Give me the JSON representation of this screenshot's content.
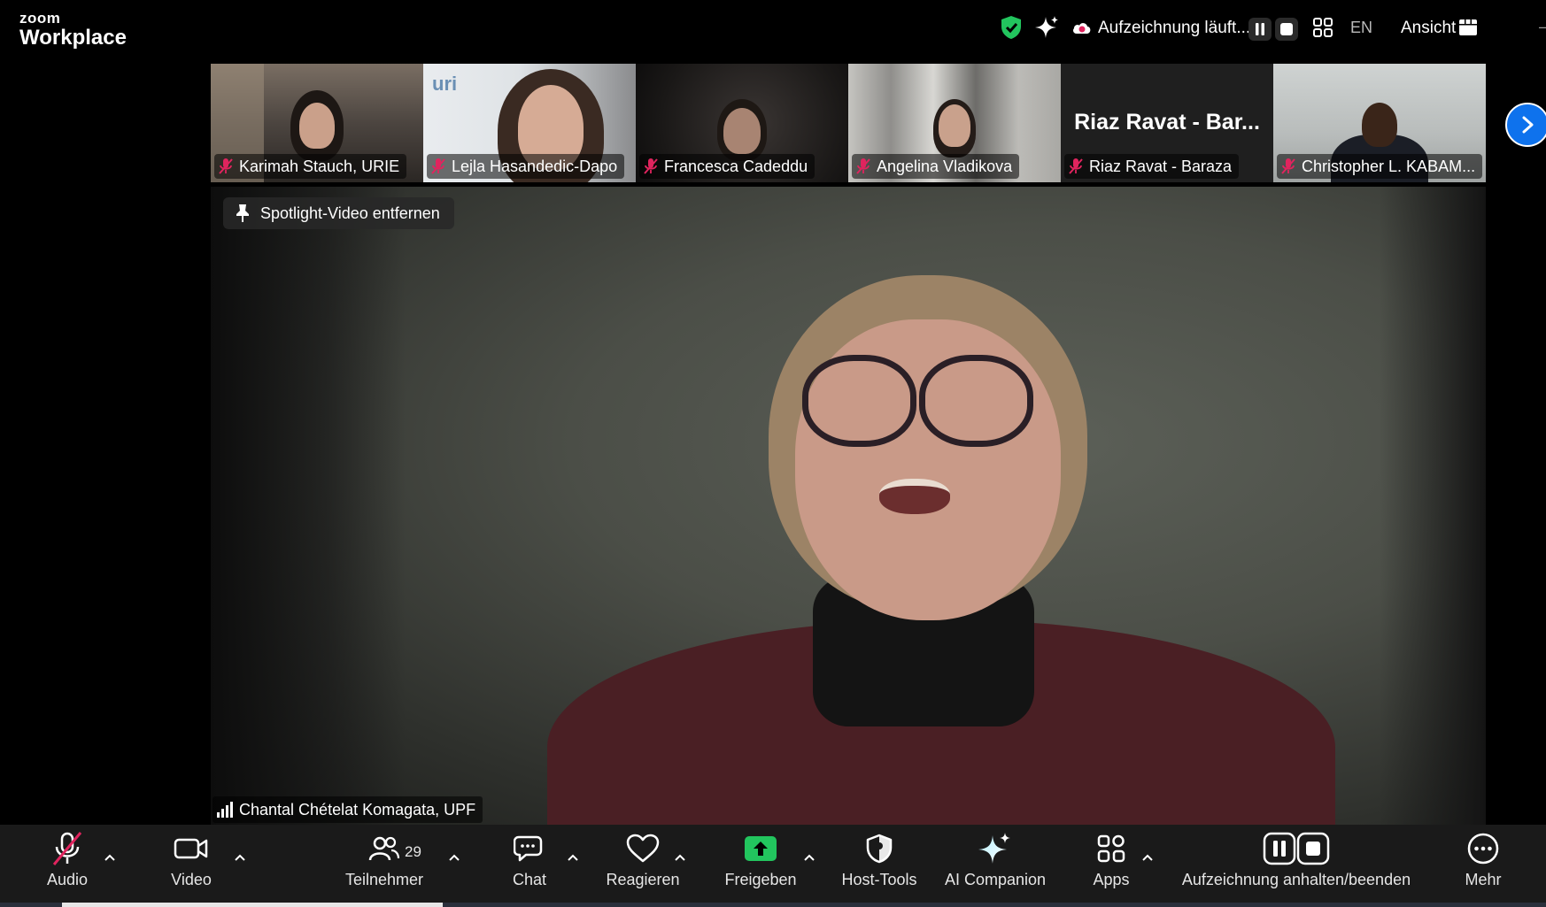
{
  "app": {
    "logo_small": "zoom",
    "logo_big": "Workplace"
  },
  "topbar": {
    "recording_text": "Aufzeichnung läuft...",
    "language": "EN",
    "view_label": "Ansicht",
    "dash": "–"
  },
  "thumbnails": [
    {
      "name": "Karimah Stauch, URIE",
      "muted": true
    },
    {
      "name": "Lejla Hasandedic-Dapo",
      "muted": true,
      "logo_text": "uri"
    },
    {
      "name": "Francesca Cadeddu",
      "muted": true
    },
    {
      "name": "Angelina Vladikova",
      "muted": true
    },
    {
      "name": "Riaz Ravat - Baraza",
      "muted": true,
      "display_name": "Riaz Ravat - Bar..."
    },
    {
      "name": "Christopher L. KABAM...",
      "muted": true
    }
  ],
  "main": {
    "spotlight_label": "Spotlight-Video entfernen",
    "speaker_name": "Chantal Chételat Komagata, UPF"
  },
  "toolbar": {
    "audio": "Audio",
    "video": "Video",
    "participants": "Teilnehmer",
    "participants_count": "29",
    "chat": "Chat",
    "react": "Reagieren",
    "share": "Freigeben",
    "host_tools": "Host-Tools",
    "ai_companion": "AI Companion",
    "apps": "Apps",
    "recording": "Aufzeichnung anhalten/beenden",
    "more": "Mehr"
  },
  "colors": {
    "accent_blue": "#0e72ed",
    "share_green": "#22c55e",
    "security_green": "#22c55e",
    "muted_red": "#e0245e",
    "toolbar_bg": "#1a1a1a"
  }
}
